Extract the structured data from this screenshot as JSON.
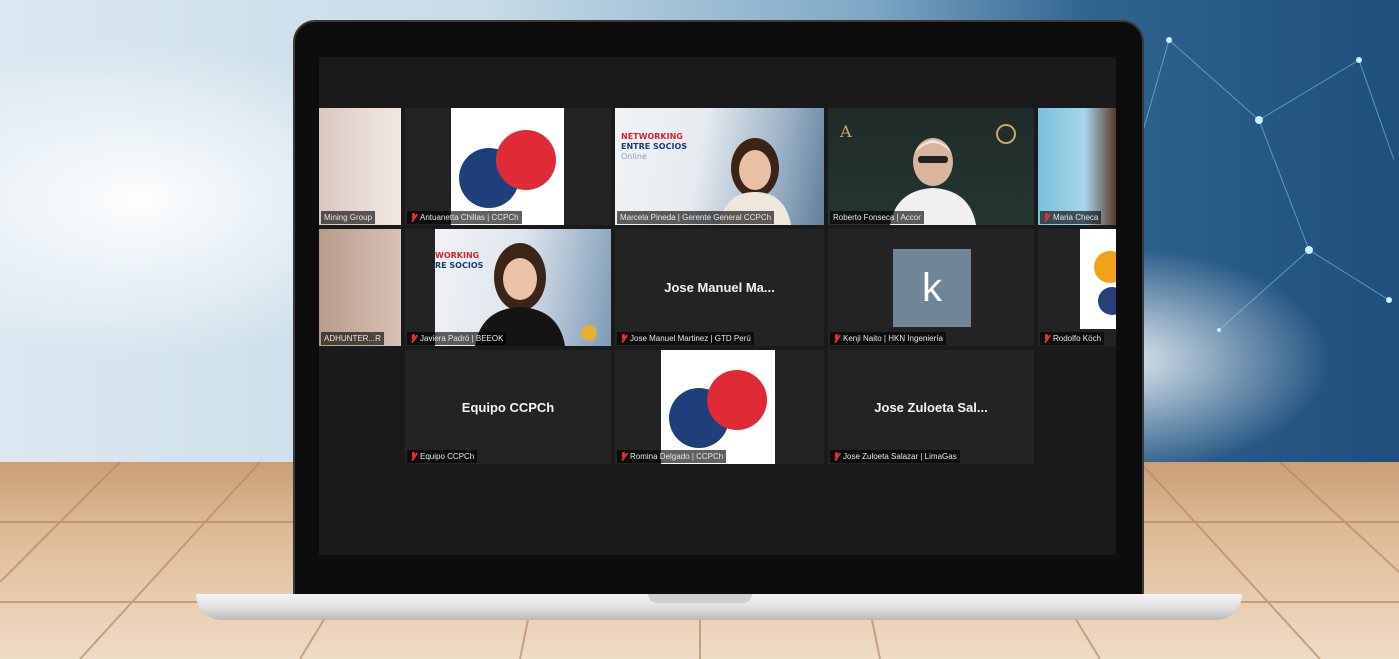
{
  "colors": {
    "screen_bg": "#1a1a1a",
    "tile_bg": "#232323",
    "active_speaker_border": "#d6e04a",
    "mic_muted": "#e0322f",
    "logo_blue": "#1f3f7a",
    "logo_red": "#e02a35",
    "avatar_k_bg": "#6f8699"
  },
  "gallery": {
    "row1": {
      "t1": {
        "name": "Mining Group"
      },
      "t2": {
        "name": "Antuanetta Chillas | CCPCh"
      },
      "t3": {
        "name": "Marcela Pineda | Gerente General CCPCh",
        "banner_line1": "NETWORKING",
        "banner_line2": "ENTRE SOCIOS",
        "banner_line3": "Online"
      },
      "t4": {
        "name": "Roberto Fonseca | Accor",
        "logo_letter": "A"
      },
      "t5": {
        "name": "Maria Checa"
      }
    },
    "row2": {
      "t1": {
        "name": "ADHUNTER...R"
      },
      "t2": {
        "name": "Javiera Padró | BEEOK",
        "banner_line1": "WORKING",
        "banner_line2": "RE SOCIOS"
      },
      "t3": {
        "name": "Jose Manuel Martinez | GTD Perú",
        "display_name": "Jose Manuel Ma..."
      },
      "t4": {
        "name": "Kenji Naito | HKN Ingeniería",
        "avatar_letter": "k"
      },
      "t5": {
        "name": "Rodolfo Köch"
      }
    },
    "row3": {
      "t1": {
        "name": "Equipo CCPCh",
        "display_name": "Equipo CCPCh"
      },
      "t2": {
        "name": "Romina Delgado | CCPCh"
      },
      "t3": {
        "name": "Jose Zuloeta Salazar | LimaGas",
        "display_name": "Jose Zuloeta Sal..."
      }
    }
  }
}
